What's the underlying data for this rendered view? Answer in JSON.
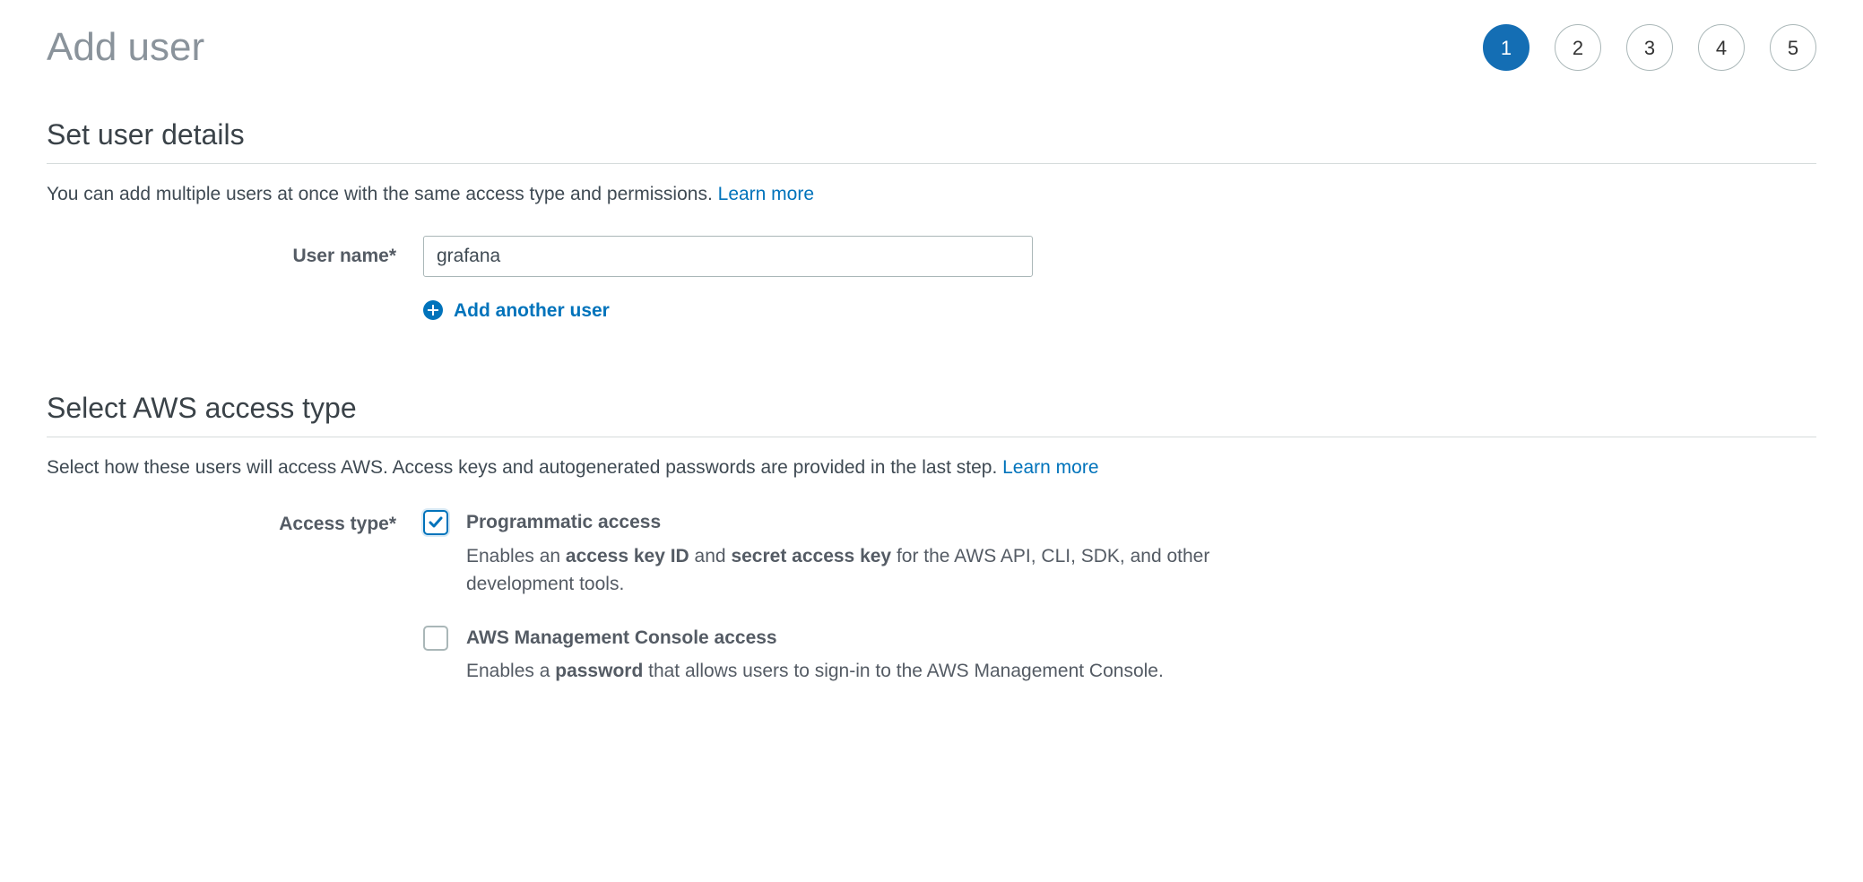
{
  "page_title": "Add user",
  "steps": [
    "1",
    "2",
    "3",
    "4",
    "5"
  ],
  "active_step_index": 0,
  "section_user_details": {
    "heading": "Set user details",
    "description": "You can add multiple users at once with the same access type and permissions. ",
    "learn_more": "Learn more",
    "username_label": "User name*",
    "username_value": "grafana",
    "add_another_label": "Add another user"
  },
  "section_access_type": {
    "heading": "Select AWS access type",
    "description": "Select how these users will access AWS. Access keys and autogenerated passwords are provided in the last step. ",
    "learn_more": "Learn more",
    "access_type_label": "Access type*",
    "options": [
      {
        "title": "Programmatic access",
        "checked": true,
        "desc_prefix": "Enables an ",
        "desc_bold1": "access key ID",
        "desc_mid": " and ",
        "desc_bold2": "secret access key",
        "desc_suffix": " for the AWS API, CLI, SDK, and other development tools."
      },
      {
        "title": "AWS Management Console access",
        "checked": false,
        "desc_prefix": "Enables a ",
        "desc_bold1": "password",
        "desc_mid": "",
        "desc_bold2": "",
        "desc_suffix": " that allows users to sign-in to the AWS Management Console."
      }
    ]
  }
}
